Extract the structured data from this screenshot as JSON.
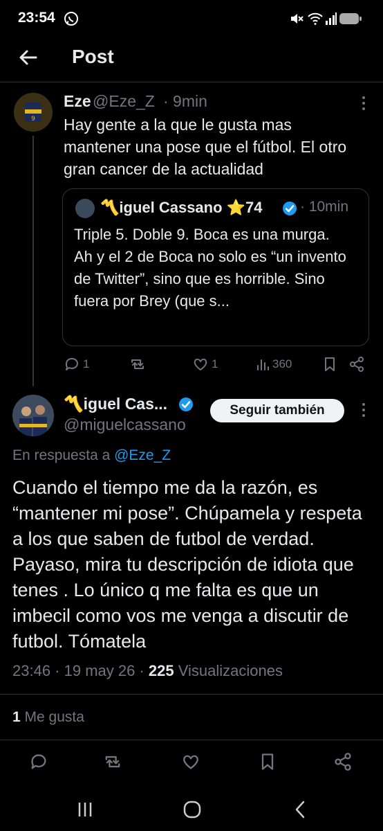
{
  "status_bar": {
    "time": "23:54"
  },
  "header": {
    "title": "Post"
  },
  "tweet1": {
    "name": "Eze",
    "handle": "@Eze_Z",
    "time": "· 9min",
    "text": "Hay gente a la que le gusta mas mantener una pose que el fútbol. El otro gran cancer de la actualidad",
    "quote": {
      "name": "〽️iguel Cassano ⭐74",
      "time": "· 10min",
      "text": "Triple 5. Doble 9. Boca es una murga.\nAh y el 2 de Boca no solo es “un invento de Twitter”, sino que es horrible. Sino fuera por Brey (que s..."
    },
    "actions": {
      "replies": "1",
      "reposts": "",
      "likes": "1",
      "views": "360"
    }
  },
  "tweet2": {
    "name": "〽️iguel Cas...",
    "handle": "@miguelcassano",
    "follow_label": "Seguir también",
    "reply_prefix": "En respuesta a",
    "reply_mention": "@Eze_Z",
    "text": "Cuando el tiempo me da la razón, es “mantener mi pose”. Chúpamela y respeta a los que saben de futbol de verdad. Payaso, mira tu descripción de idiota que tenes . Lo único q me falta es que un imbecil como vos me venga a discutir de futbol. Tómatela",
    "time": "23:46",
    "date": "19 may 26",
    "views_count": "225",
    "views_label": "Visualizaciones",
    "likes_count": "1",
    "likes_label": "Me gusta"
  },
  "colors": {
    "background": "#000000",
    "accent": "#1d9bf0",
    "muted": "#71767b",
    "divider": "#2f3336",
    "star": "#f5c518"
  },
  "icons": [
    "whatsapp-icon",
    "mute-icon",
    "wifi-icon",
    "signal-icon",
    "battery-icon",
    "back-arrow-icon",
    "more-icon",
    "verified-icon",
    "reply-icon",
    "repost-icon",
    "like-icon",
    "views-icon",
    "bookmark-icon",
    "share-icon",
    "recents-icon",
    "home-icon",
    "back-nav-icon"
  ]
}
